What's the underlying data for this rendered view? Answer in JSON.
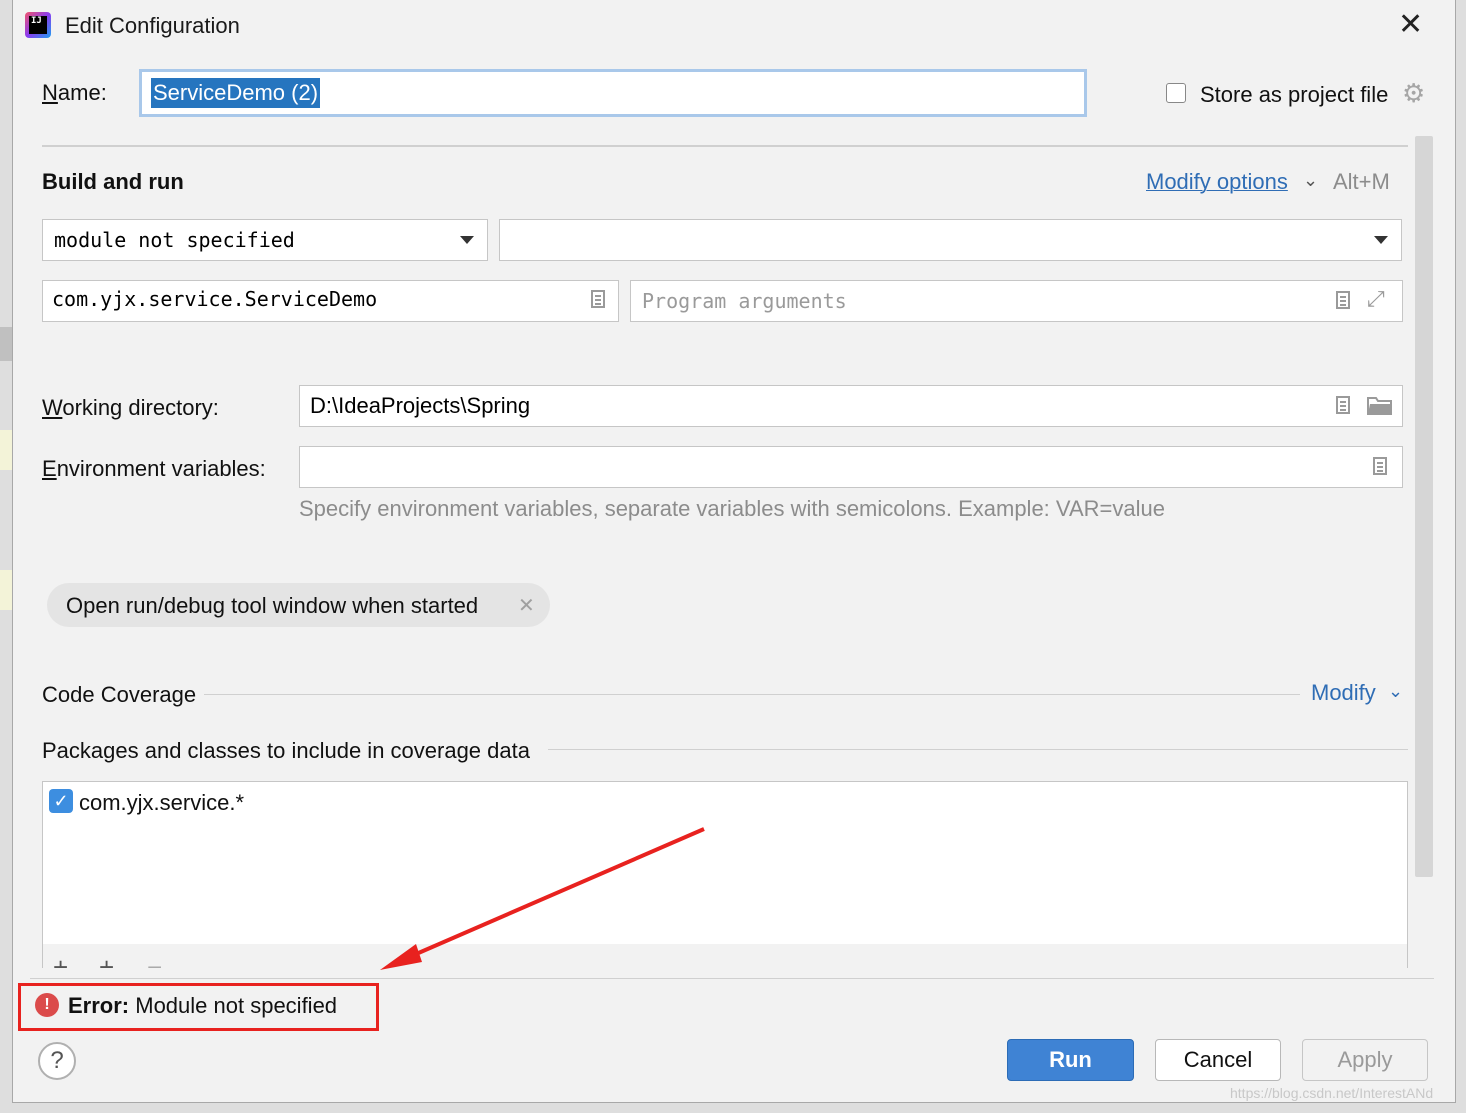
{
  "window": {
    "title": "Edit Configuration",
    "app_icon_text": "IJ"
  },
  "name": {
    "label": "Name:",
    "value": "ServiceDemo (2)"
  },
  "store_project_file": {
    "label": "Store as project file",
    "checked": false
  },
  "build_and_run": {
    "heading": "Build and run",
    "modify_options": "Modify options",
    "shortcut": "Alt+M",
    "module_select": "module not specified",
    "jdk_select": "",
    "main_class": "com.yjx.service.ServiceDemo",
    "program_args_placeholder": "Program arguments"
  },
  "working_directory": {
    "label": "Working directory:",
    "value": "D:\\IdeaProjects\\Spring"
  },
  "env_vars": {
    "label": "Environment variables:",
    "value": "",
    "hint": "Specify environment variables, separate variables with semicolons. Example: VAR=value"
  },
  "chip": {
    "label": "Open run/debug tool window when started"
  },
  "code_coverage": {
    "heading": "Code Coverage",
    "modify": "Modify",
    "packages_heading": "Packages and classes to include in coverage data",
    "items": [
      {
        "label": "com.yjx.service.*",
        "checked": true
      }
    ]
  },
  "error": {
    "prefix": "Error:",
    "message": "Module not specified"
  },
  "buttons": {
    "help": "?",
    "run": "Run",
    "cancel": "Cancel",
    "apply": "Apply"
  },
  "watermark": "https://blog.csdn.net/InterestANd",
  "colors": {
    "accent": "#2f6db5",
    "run_button": "#3f83d4",
    "error_frame": "#e8221f",
    "arrow": "#e8221f"
  }
}
